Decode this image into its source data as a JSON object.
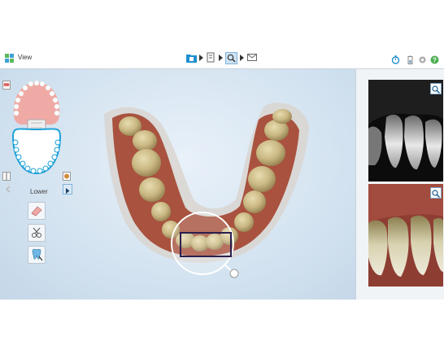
{
  "toolbar": {
    "view_label": "View",
    "workflow_steps": [
      "folder-step-icon",
      "document-step-icon",
      "magnifier-step-icon",
      "envelope-step-icon"
    ],
    "right_icons": [
      "stopwatch-icon",
      "battery-icon",
      "gear-icon",
      "help-icon"
    ]
  },
  "left_panel": {
    "jaw_label": "Lower",
    "tools": [
      "eraser-tool-icon",
      "trim-tool-icon",
      "tooth-tool-icon"
    ]
  },
  "colors": {
    "accent": "#1f8fd0",
    "help_green": "#4caf50",
    "upper_arch": "#f0aaa5",
    "lower_arch_outline": "#1aa0d8"
  }
}
